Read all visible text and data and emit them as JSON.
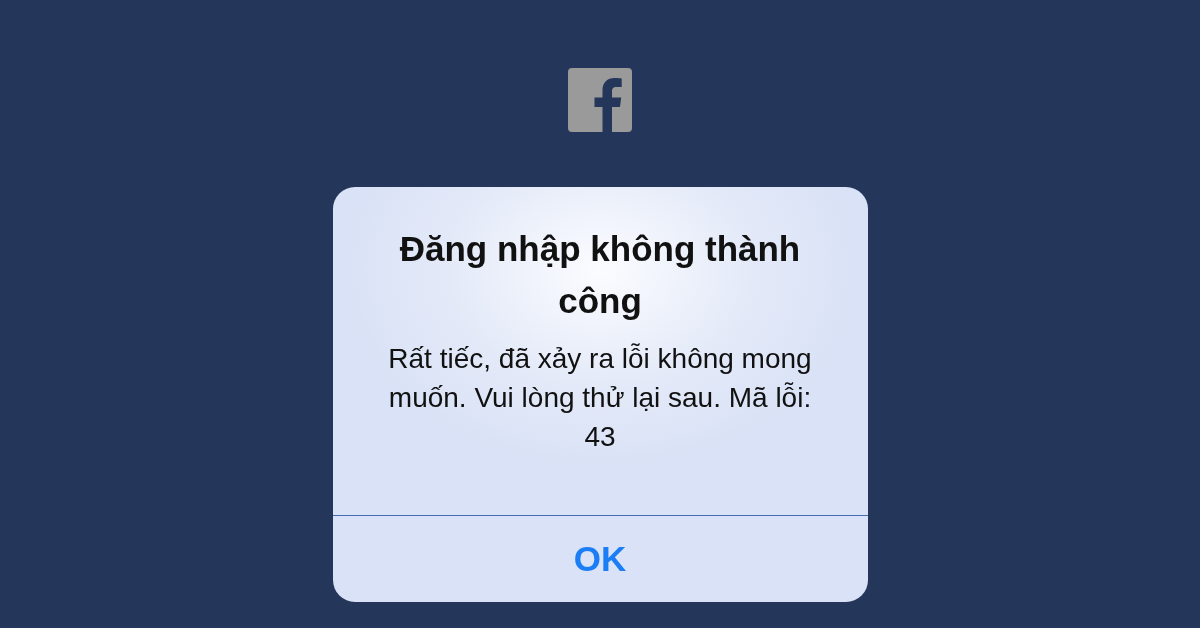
{
  "alert": {
    "title": "Đăng nhập không thành công",
    "message": "Rất tiếc, đã xảy ra lỗi không mong muốn. Vui lòng thử lại sau. Mã lỗi: 43",
    "buttons": [
      "OK"
    ]
  }
}
